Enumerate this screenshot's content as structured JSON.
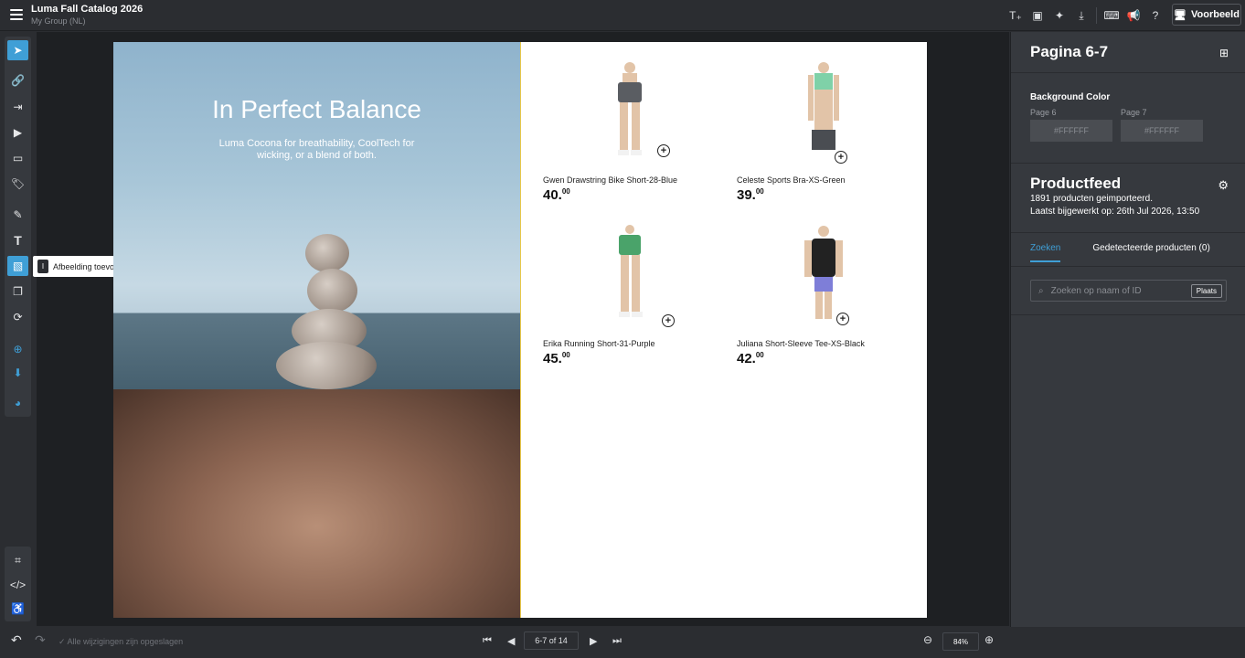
{
  "header": {
    "title": "Luma Fall Catalog 2026",
    "subtitle": "My Group (NL)",
    "preview_label": "Voorbeeld",
    "icons": [
      "text-insert-icon",
      "page-add-icon",
      "magic-wand-icon",
      "download-icon",
      "keyboard-icon",
      "megaphone-icon",
      "help-icon",
      "monitor-icon"
    ]
  },
  "tooltip": {
    "key": "I",
    "label": "Afbeelding toevoegen"
  },
  "spread": {
    "headline": "In Perfect Balance",
    "subline": "Luma Cocona for breathability, CoolTech for wicking, or a blend of both.",
    "products": [
      {
        "name": "Gwen Drawstring Bike Short-28-Blue",
        "price_main": "40.",
        "price_cents": "00"
      },
      {
        "name": "Celeste Sports Bra-XS-Green",
        "price_main": "39.",
        "price_cents": "00"
      },
      {
        "name": "Erika Running Short-31-Purple",
        "price_main": "45.",
        "price_cents": "00"
      },
      {
        "name": "Juliana Short-Sleeve Tee-XS-Black",
        "price_main": "42.",
        "price_cents": "00"
      }
    ]
  },
  "panel": {
    "page_title": "Pagina 6-7",
    "bg_label": "Background Color",
    "page6_label": "Page 6",
    "page7_label": "Page 7",
    "page6_color": "#FFFFFF",
    "page7_color": "#FFFFFF",
    "feed_title": "Productfeed",
    "feed_count": "1891 producten geimporteerd.",
    "feed_updated": "Laatst bijgewerkt op: 26th Jul 2026, 13:50",
    "tab_search": "Zoeken",
    "tab_detected": "Gedetecteerde producten (0)",
    "search_placeholder": "Zoeken op naam of ID",
    "place_button": "Plaats"
  },
  "footer": {
    "saved_status": "Alle wijzigingen zijn opgeslagen",
    "page_indicator": "6-7 of 14",
    "zoom_level": "84%"
  },
  "colors": {
    "accent": "#3f9fd6",
    "bg_dark": "#2b2d31",
    "panel": "#36393e",
    "guide": "#e8c84a"
  }
}
